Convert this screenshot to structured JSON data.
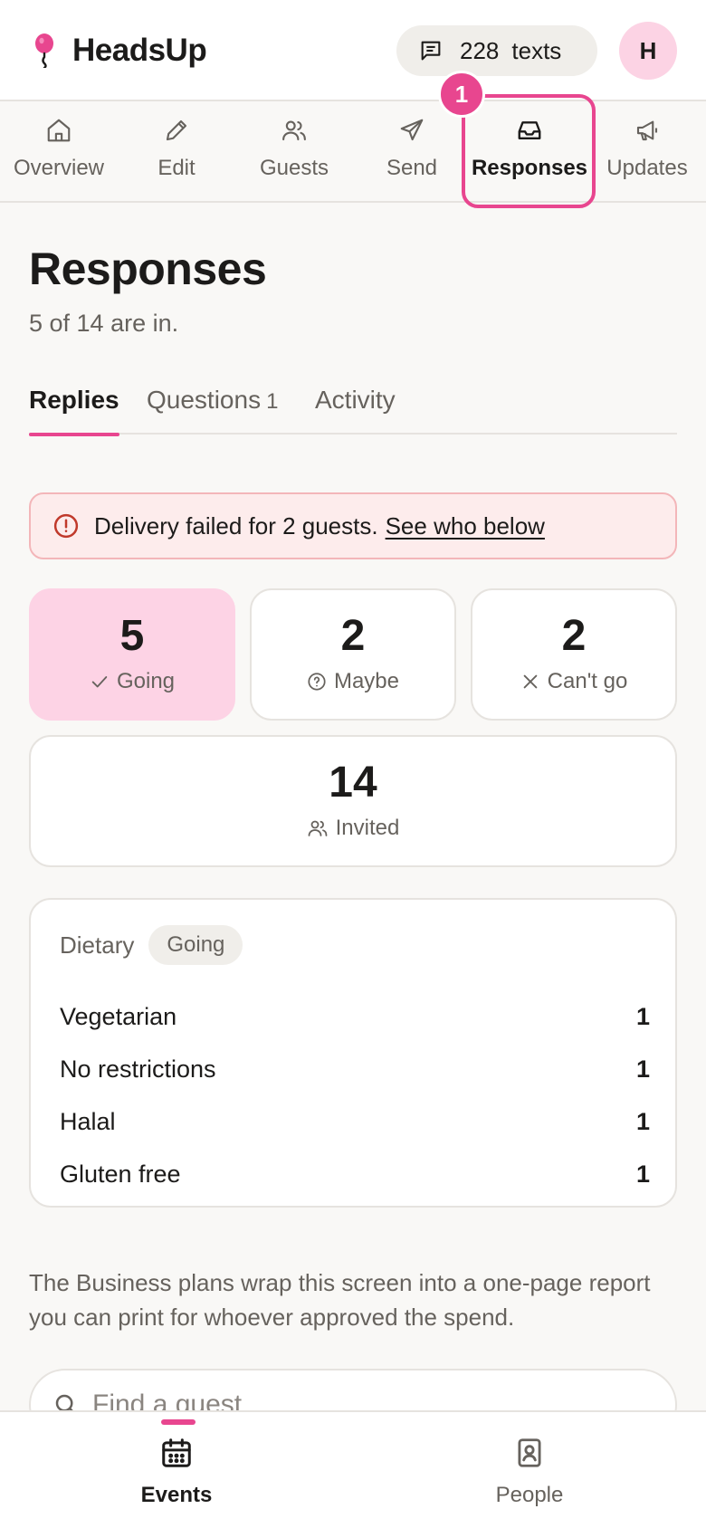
{
  "header": {
    "brand": "HeadsUp",
    "credits_count": "228",
    "credits_unit": "texts",
    "avatar_initial": "H"
  },
  "nav": {
    "items": [
      {
        "label": "Overview",
        "icon": "home-icon"
      },
      {
        "label": "Edit",
        "icon": "pencil-icon"
      },
      {
        "label": "Guests",
        "icon": "users-icon"
      },
      {
        "label": "Send",
        "icon": "send-icon"
      },
      {
        "label": "Responses",
        "icon": "inbox-icon",
        "active": true
      },
      {
        "label": "Updates",
        "icon": "megaphone-icon"
      }
    ],
    "step_badge": "1"
  },
  "page": {
    "title": "Responses",
    "subtitle": "5 of 14 are in."
  },
  "tabs": {
    "replies": "Replies",
    "questions": "Questions",
    "questions_count": "1",
    "activity": "Activity"
  },
  "alert": {
    "text": "Delivery failed for 2 guests.",
    "link": "See who below"
  },
  "stats": {
    "going": {
      "value": "5",
      "label": "Going"
    },
    "maybe": {
      "value": "2",
      "label": "Maybe"
    },
    "cant_go": {
      "value": "2",
      "label": "Can't go"
    },
    "invited": {
      "value": "14",
      "label": "Invited"
    }
  },
  "dietary": {
    "title": "Dietary",
    "filter": "Going",
    "rows": [
      {
        "label": "Vegetarian",
        "value": "1"
      },
      {
        "label": "No restrictions",
        "value": "1"
      },
      {
        "label": "Halal",
        "value": "1"
      },
      {
        "label": "Gluten free",
        "value": "1"
      }
    ]
  },
  "upsell": {
    "text": "The Business plans wrap this screen into a one-page report you can print for whoever approved the spend."
  },
  "search": {
    "placeholder": "Find a guest"
  },
  "bottom_nav": {
    "events": "Events",
    "people": "People"
  },
  "colors": {
    "accent": "#e8468f",
    "going_bg": "#fdd3e5",
    "alert_bg": "#fdecec",
    "alert_icon": "#c0392b"
  }
}
